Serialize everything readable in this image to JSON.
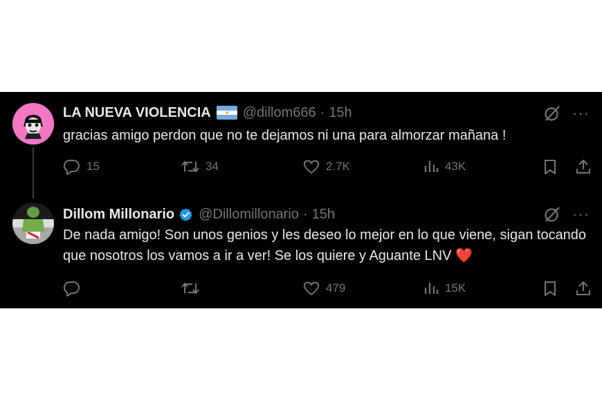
{
  "tweets": [
    {
      "display_name": "LA NUEVA VIOLENCIA",
      "handle": "@dillom666",
      "separator": "·",
      "time": "15h",
      "text": "gracias amigo perdon que no te dejamos ni una para almorzar mañana !",
      "replies": "15",
      "retweets": "34",
      "likes": "2.7K",
      "views": "43K",
      "flag_icon": "argentina-flag-icon",
      "avatar_color": "#f577c4"
    },
    {
      "display_name": "Dillom Millonario",
      "handle": "@Dillomillonario",
      "separator": "·",
      "time": "15h",
      "text": "De nada amigo! Son unos genios y les deseo lo mejor en lo que viene, sigan tocando que nosotros los vamos a ir a ver! Se los quiere y Aguante LNV ❤️",
      "replies": "",
      "retweets": "",
      "likes": "479",
      "views": "15K",
      "verified_icon": "verified-badge-icon"
    }
  ],
  "more_label": "···",
  "colors": {
    "background": "#000000",
    "text": "#e7e9ea",
    "muted": "#71767b",
    "verified": "#1d9bf0"
  }
}
